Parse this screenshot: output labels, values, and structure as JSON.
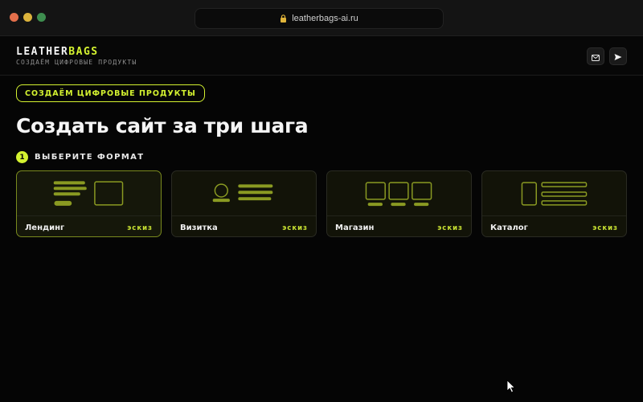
{
  "browser": {
    "url": "leatherbags-ai.ru"
  },
  "header": {
    "logo_part1": "LEATHER",
    "logo_part2": "BAGS",
    "tagline": "СОЗДАЁМ ЦИФРОВЫЕ ПРОДУКТЫ",
    "icons": [
      "mail-icon",
      "send-icon"
    ]
  },
  "main": {
    "pill": "СОЗДАЁМ ЦИФРОВЫЕ ПРОДУКТЫ",
    "title": "Создать сайт за три шага",
    "step": {
      "number": "1",
      "label": "ВЫБЕРИТЕ ФОРМАТ"
    },
    "cards": [
      {
        "name": "Лендинг",
        "tag": "эскиз",
        "selected": true
      },
      {
        "name": "Визитка",
        "tag": "эскиз",
        "selected": false
      },
      {
        "name": "Магазин",
        "tag": "эскиз",
        "selected": false
      },
      {
        "name": "Каталог",
        "tag": "эскиз",
        "selected": false
      }
    ]
  },
  "colors": {
    "accent": "#d4f230",
    "background": "#050505",
    "sketch": "#8a9a22"
  }
}
